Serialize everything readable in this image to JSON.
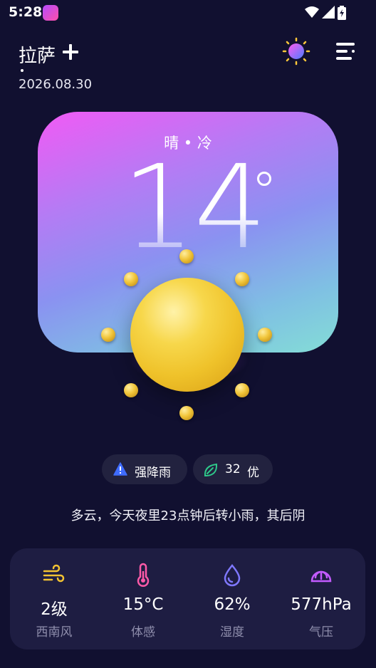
{
  "status": {
    "time": "5:28"
  },
  "header": {
    "city": "拉萨",
    "date": "2026.08.30"
  },
  "current": {
    "condition": "晴 • 冷",
    "temperature": "14"
  },
  "badges": {
    "warning": "强降雨",
    "aqi_value": "32",
    "aqi_level": "优"
  },
  "summary": "多云，今天夜里23点钟后转小雨，其后阴",
  "details": [
    {
      "icon": "wind-icon",
      "value": "2级",
      "label": "西南风",
      "color": "#f2c232"
    },
    {
      "icon": "thermometer-icon",
      "value": "15°C",
      "label": "体感",
      "color": "#ff5aa8"
    },
    {
      "icon": "droplet-icon",
      "value": "62%",
      "label": "湿度",
      "color": "#7f78ff"
    },
    {
      "icon": "gauge-icon",
      "value": "577hPa",
      "label": "气压",
      "color": "#c35bff"
    }
  ],
  "colors": {
    "background": "#111030",
    "card": "#1e1d42",
    "chip": "#22223f"
  }
}
